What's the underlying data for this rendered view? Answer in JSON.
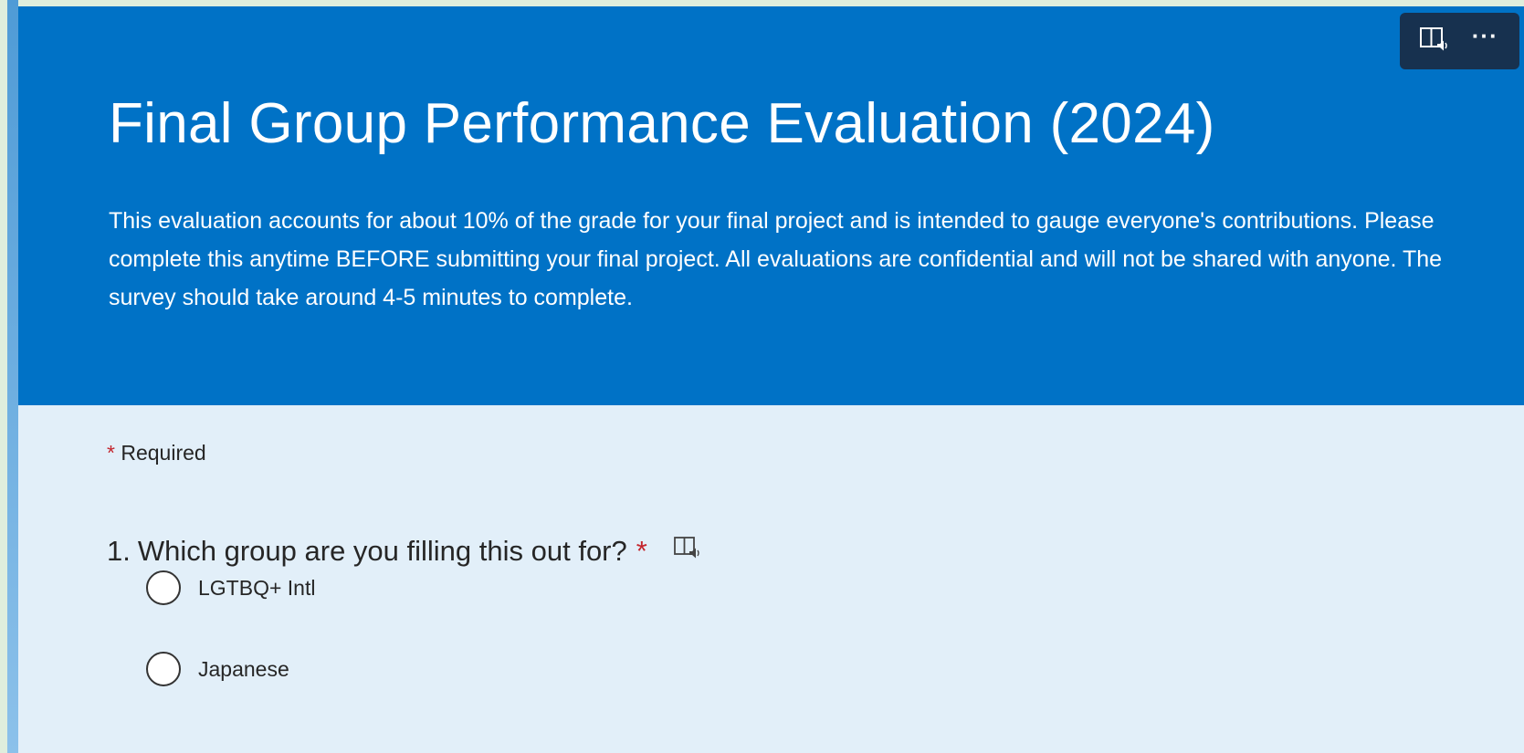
{
  "header": {
    "title": "Final Group Performance Evaluation (2024)",
    "description": "This evaluation accounts for about 10% of the grade for your final project and is intended to gauge everyone's contributions. Please complete this anytime BEFORE submitting your final project. All evaluations are confidential and will not be shared with anyone. The survey should take around 4-5 minutes to complete.",
    "background_color": "#0072c6"
  },
  "toolbar": {
    "buttons": [
      {
        "icon": "immersive-reader-icon"
      },
      {
        "icon": "more-options-icon",
        "label": "···"
      }
    ]
  },
  "form": {
    "required_marker": "*",
    "required_text": "Required",
    "questions": [
      {
        "number": "1.",
        "text": "Which group are you filling this out for?",
        "required_marker": "*",
        "icon": "immersive-reader-icon",
        "options": [
          {
            "label": "LGTBQ+ Intl",
            "selected": false
          },
          {
            "label": "Japanese",
            "selected": false
          }
        ]
      }
    ]
  },
  "colors": {
    "header": "#0072c6",
    "body": "#e2eff9",
    "required_star": "#c4262e",
    "toolbar": "#17314f"
  }
}
